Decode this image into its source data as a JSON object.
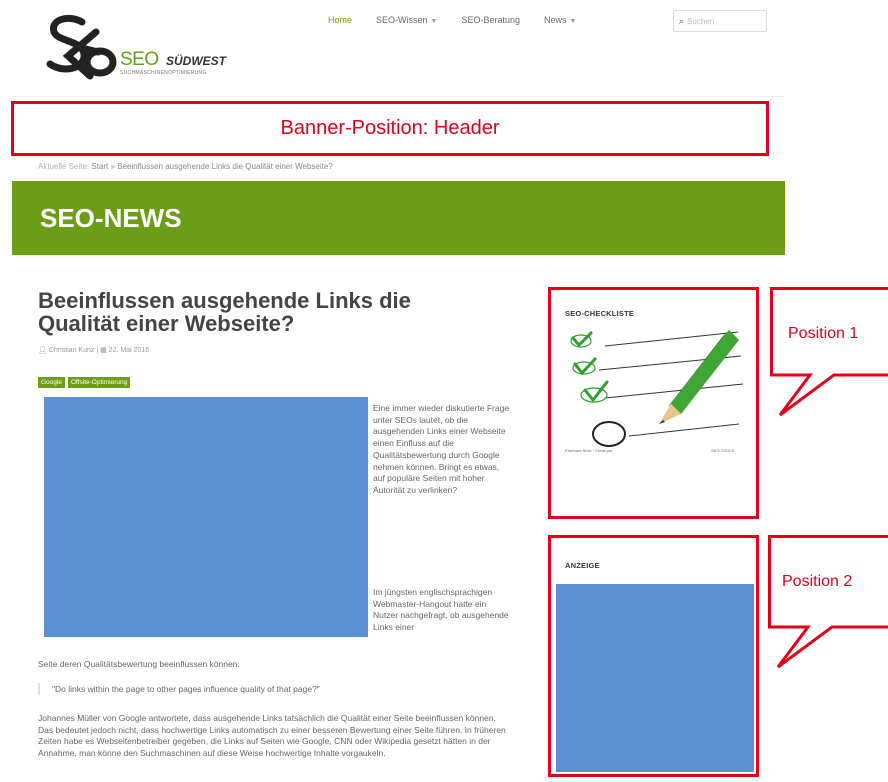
{
  "logo": {
    "seo": "SEO",
    "sued": "SÜDWEST",
    "tagline": "SUCHMASCHINENOPTIMIERUNG"
  },
  "nav": {
    "items": [
      {
        "label": "Home",
        "active": true,
        "dropdown": false
      },
      {
        "label": "SEO-Wissen",
        "active": false,
        "dropdown": true
      },
      {
        "label": "SEO-Beratung",
        "active": false,
        "dropdown": false
      },
      {
        "label": "News",
        "active": false,
        "dropdown": true
      }
    ],
    "search_placeholder": "Suchen"
  },
  "banner": {
    "label": "Banner-Position: Header"
  },
  "breadcrumb": {
    "prefix": "Aktuelle Seite:",
    "home": "Start",
    "separator": "»",
    "current": "Beeinflussen ausgehende Links die Qualität einer Webseite?"
  },
  "section": {
    "title": "SEO-NEWS"
  },
  "article": {
    "title": "Beeinflussen ausgehende Links die Qualität einer Webseite?",
    "author": "Christian Kunz",
    "date": "22. Mai 2016",
    "tags": [
      "Google",
      "Offsite-Optimierung"
    ],
    "side_paragraph_1": "Eine immer wieder diskutierte Frage unter SEOs lautet, ob die ausgehenden Links einer Webseite einen Einfluss auf die Qualitätsbewertung durch Google nehmen können. Bringt es etwas, auf populäre Seiten mit hoher Autorität zu verlinken?",
    "side_paragraph_2": "Im jüngsten englischsprachigen Webmaster-Hangout hatte ein Nutzer nachgefragt, ob ausgehende Links einer",
    "continuation": "Seite deren Qualitätsbewertung beeinflussen können:",
    "quote": "\"Do links within the page to other pages influence quality of that page?\"",
    "body": "Johannes Müller von Google antwortete, dass ausgehende Links tatsächlich die Qualität einer Seite beeinflussen können. Das bedeutet jedoch nicht, dass hochwertige Links automatisch zu einer besseren Bewertung einer Seite führen. In früheren Zeiten habe es Webseitenbetreiber gegeben, die Links auf Seiten wie Google, CNN oder Wikipedia gesetzt hätten in der Annahme, man könne den Suchmaschinen auf diese Weise hochwertige Inhalte vorgaukeln."
  },
  "sidebar": {
    "box1_title": "SEO-CHECKLISTE",
    "box1_footer_left": "Eberhard Stolz · Christ.pro",
    "box1_footer_right": "SEO-TOOLS",
    "box2_title": "ANZEIGE"
  },
  "callouts": {
    "position1": "Position  1",
    "position2": "Position  2"
  },
  "colors": {
    "brand_green": "#6b9e16",
    "annotation_red": "#e3001b",
    "placeholder_blue": "#5b8fd6"
  }
}
